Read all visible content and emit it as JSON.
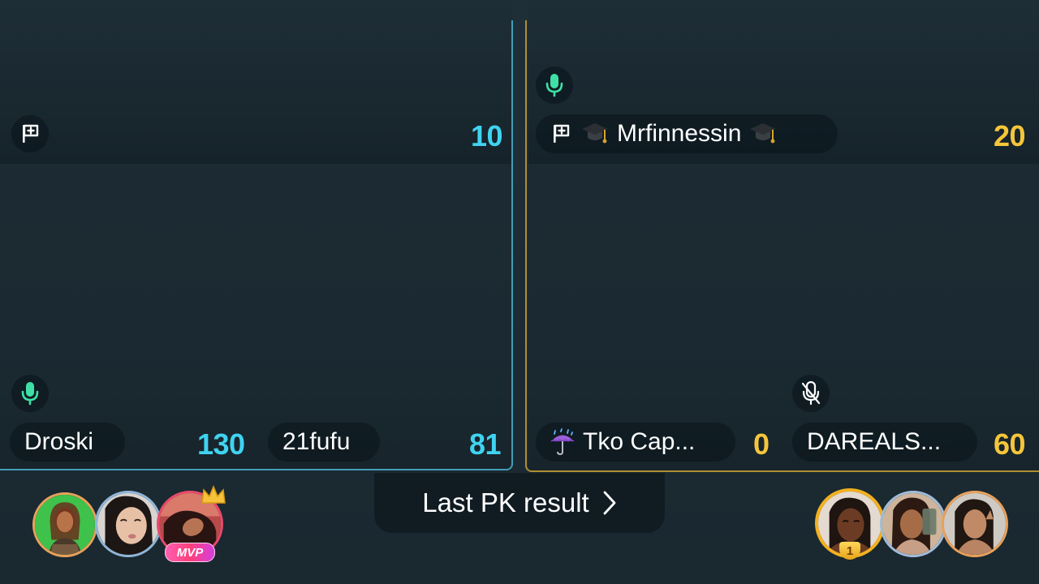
{
  "left_team": {
    "top_score": "10",
    "players": [
      {
        "name": "Droski",
        "score": "130"
      },
      {
        "name": "21fufu",
        "score": "81"
      }
    ]
  },
  "right_team": {
    "host_name": "Mrfinnessin",
    "top_score": "20",
    "players": [
      {
        "name": "Tko Cap...",
        "score": "0"
      },
      {
        "name": "DAREALS...",
        "score": "60"
      }
    ]
  },
  "result_button": {
    "label": "Last PK result"
  },
  "badges": {
    "mvp": "MVP",
    "rank_one": "1"
  },
  "icons": {
    "flag": "flag-icon",
    "mic_on": "microphone-icon",
    "mic_off": "microphone-muted-icon",
    "cap": "graduation-cap-icon",
    "umbrella": "umbrella-rain-icon",
    "chevron": "chevron-right-icon"
  },
  "colors": {
    "blue_team": "#3fd3f0",
    "gold_team": "#f5c63a",
    "mic_green": "#3ee0a6"
  }
}
